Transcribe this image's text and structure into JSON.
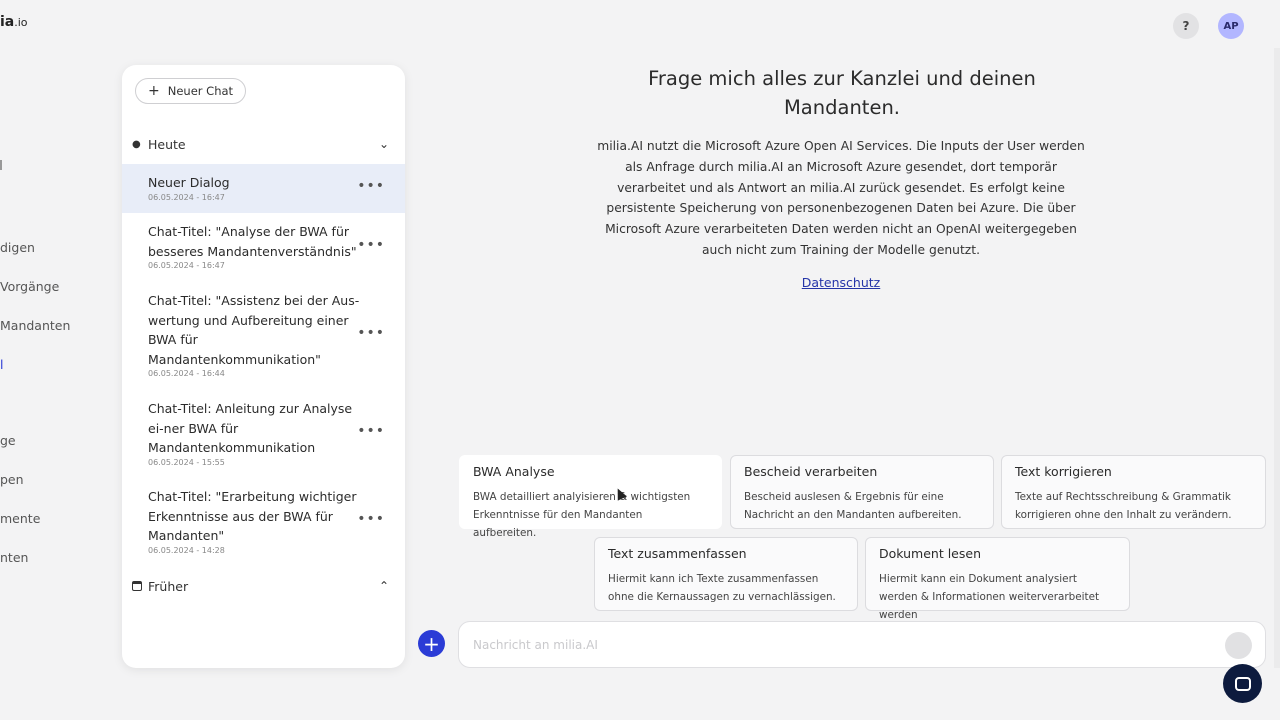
{
  "app": {
    "logo_text": "ia",
    "logo_suffix": ".io"
  },
  "leftnav": {
    "items": [
      {
        "label": "digen"
      },
      {
        "label": "Vorgänge"
      },
      {
        "label": "Mandanten"
      },
      {
        "label": "l"
      },
      {
        "label": "ge"
      },
      {
        "label": "pen"
      },
      {
        "label": "mente"
      },
      {
        "label": "nten"
      }
    ]
  },
  "header": {
    "help_label": "?",
    "avatar_initials": "AP"
  },
  "sidebar": {
    "new_chat_label": "Neuer Chat",
    "section_today": "Heute",
    "section_earlier": "Früher",
    "chats": [
      {
        "title": "Neuer Dialog",
        "date": "06.05.2024 - 16:47"
      },
      {
        "title": "Chat-Titel: \"Analyse der BWA für besseres Mandantenverständnis\"",
        "date": "06.05.2024 - 16:47"
      },
      {
        "title": "Chat-Titel: \"Assistenz bei der Aus-wertung und Aufbereitung einer BWA für Mandantenkommunikation\"",
        "date": "06.05.2024 - 16:44"
      },
      {
        "title": "Chat-Titel: Anleitung zur Analyse ei-ner BWA für Mandantenkommunikation",
        "date": "06.05.2024 - 15:55"
      },
      {
        "title": "Chat-Titel: \"Erarbeitung wichtiger Erkenntnisse aus der BWA für Mandanten\"",
        "date": "06.05.2024 - 14:28"
      }
    ],
    "more_label": "•••"
  },
  "main": {
    "headline": "Frage mich alles zur Kanzlei und deinen Mandanten.",
    "info": "milia.AI nutzt die Microsoft Azure Open AI Services. Die Inputs der User werden als Anfrage durch milia.AI an Microsoft Azure gesendet, dort temporär verarbeitet und als Antwort an milia.AI zurück gesendet. Es erfolgt keine persistente Speicherung von personenbezogenen Daten bei Azure. Die über Microsoft Azure verarbeiteten Daten werden nicht an OpenAI weitergegeben auch nicht zum Training der Modelle genutzt.",
    "privacy_link": "Datenschutz",
    "cards": [
      {
        "title": "BWA Analyse",
        "desc": "BWA detailliert analyisieren & wichtigsten Erkenntnisse für den Mandanten aufbereiten."
      },
      {
        "title": "Bescheid verarbeiten",
        "desc": "Bescheid auslesen & Ergebnis für eine Nachricht an den Mandanten aufbereiten."
      },
      {
        "title": "Text korrigieren",
        "desc": "Texte auf Rechtsschreibung & Grammatik korrigieren ohne den Inhalt zu verändern."
      },
      {
        "title": "Text zusammenfassen",
        "desc": "Hiermit kann ich Texte zusammenfassen ohne die Kernaussagen zu vernachlässigen."
      },
      {
        "title": "Dokument lesen",
        "desc": "Hiermit kann ein Dokument analysiert werden & Informationen weiterverarbeitet werden"
      }
    ],
    "add_label": "+",
    "message_placeholder": "Nachricht an milia.AI"
  },
  "colors": {
    "accent": "#2b3cd6",
    "selected_row": "#e8edf8",
    "avatar_bg": "#b2b6ff",
    "support_bubble": "#0d1b3e"
  }
}
